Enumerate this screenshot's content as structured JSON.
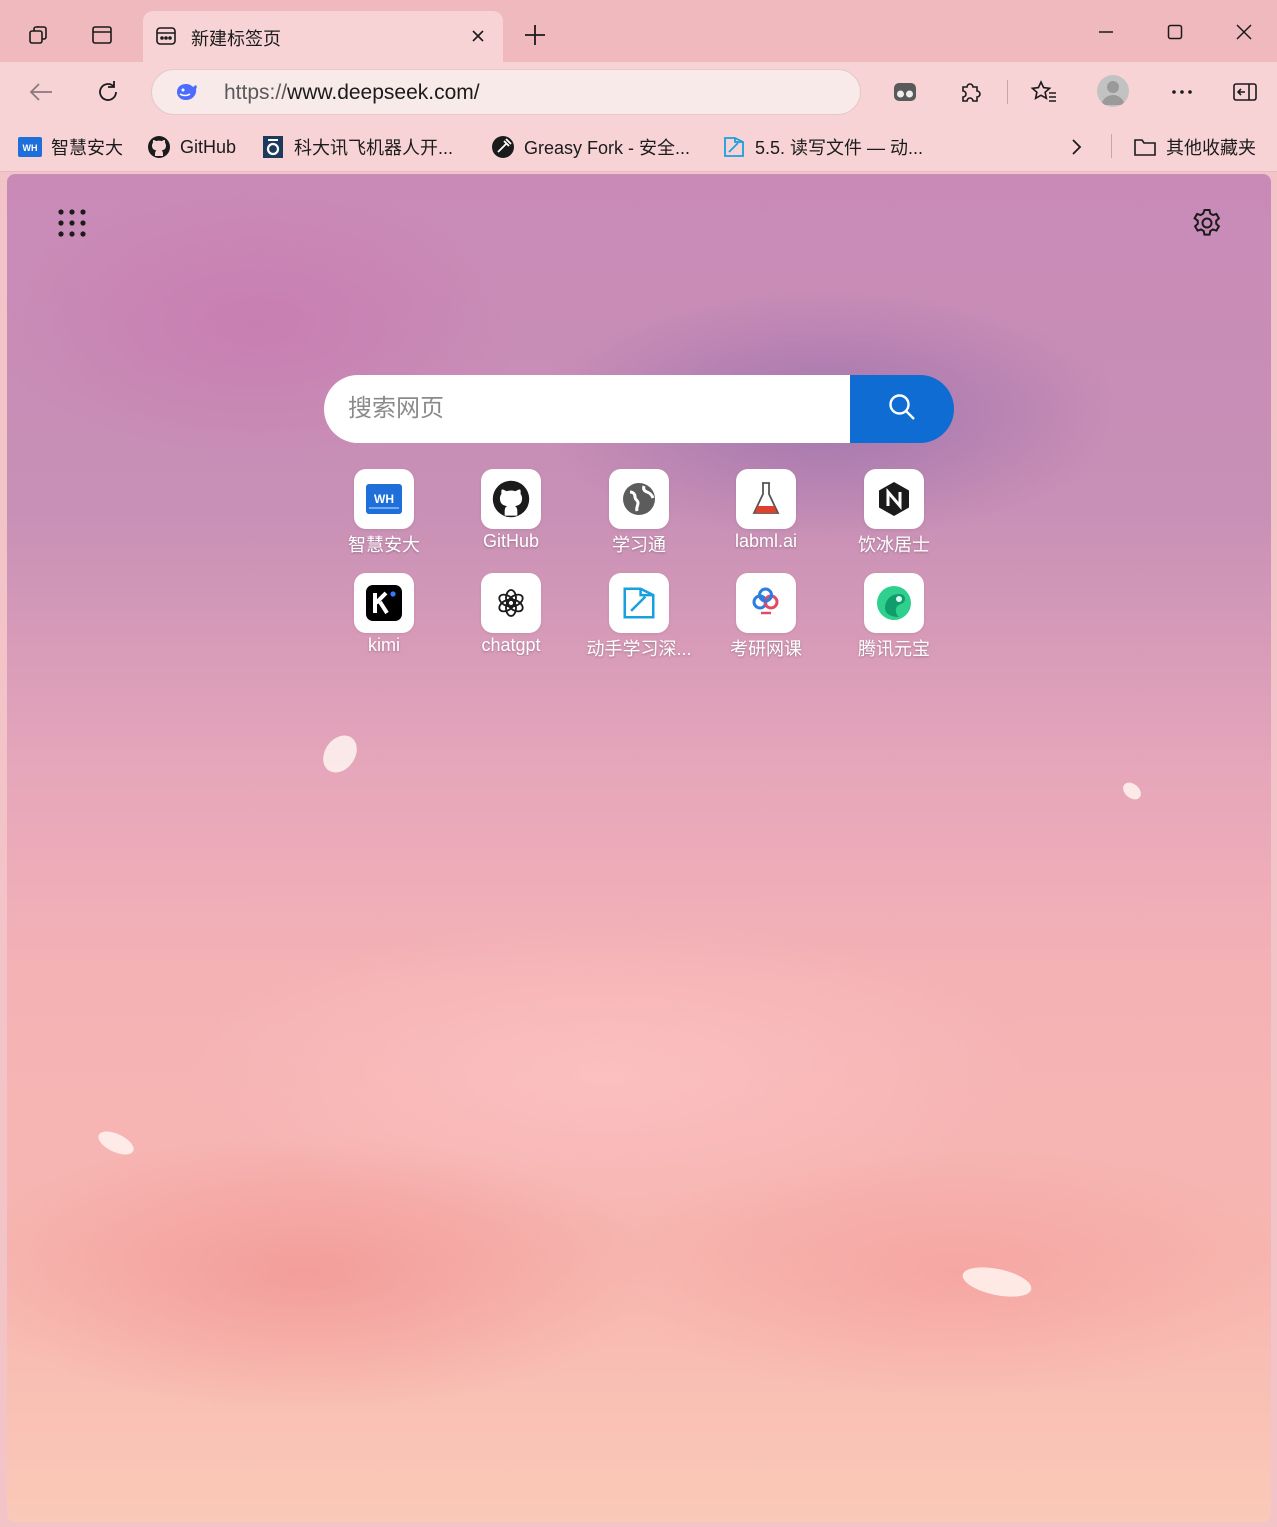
{
  "titlebar": {
    "tab_title": "新建标签页",
    "controls": [
      "minimize",
      "maximize",
      "close"
    ]
  },
  "navbar": {
    "url_protocol": "https://",
    "url_rest": "www.deepseek.com/"
  },
  "bookmarks": [
    {
      "label": "智慧安大",
      "icon": "ahu-icon"
    },
    {
      "label": "GitHub",
      "icon": "github-icon"
    },
    {
      "label": "科大讯飞机器人开...",
      "icon": "iflytek-icon"
    },
    {
      "label": "Greasy Fork - 安全...",
      "icon": "greasyfork-icon"
    },
    {
      "label": "5.5. 读写文件 — 动...",
      "icon": "d2l-icon"
    }
  ],
  "other_bookmarks": "其他收藏夹",
  "search": {
    "placeholder": "搜索网页"
  },
  "quick_links": [
    {
      "label": "智慧安大",
      "icon": "ahu-icon"
    },
    {
      "label": "GitHub",
      "icon": "github-icon"
    },
    {
      "label": "学习通",
      "icon": "globe-icon"
    },
    {
      "label": "labml.ai",
      "icon": "flask-icon"
    },
    {
      "label": "饮冰居士",
      "icon": "notion-icon"
    },
    {
      "label": "kimi",
      "icon": "kimi-icon"
    },
    {
      "label": "chatgpt",
      "icon": "openai-icon"
    },
    {
      "label": "动手学习深...",
      "icon": "d2l-icon"
    },
    {
      "label": "考研网课",
      "icon": "kaoyan-icon"
    },
    {
      "label": "腾讯元宝",
      "icon": "yuanbao-icon"
    }
  ],
  "colors": {
    "accent": "#0f6cd2",
    "titlebar": "#efb9bd",
    "toolbar": "#f7d3d6"
  }
}
